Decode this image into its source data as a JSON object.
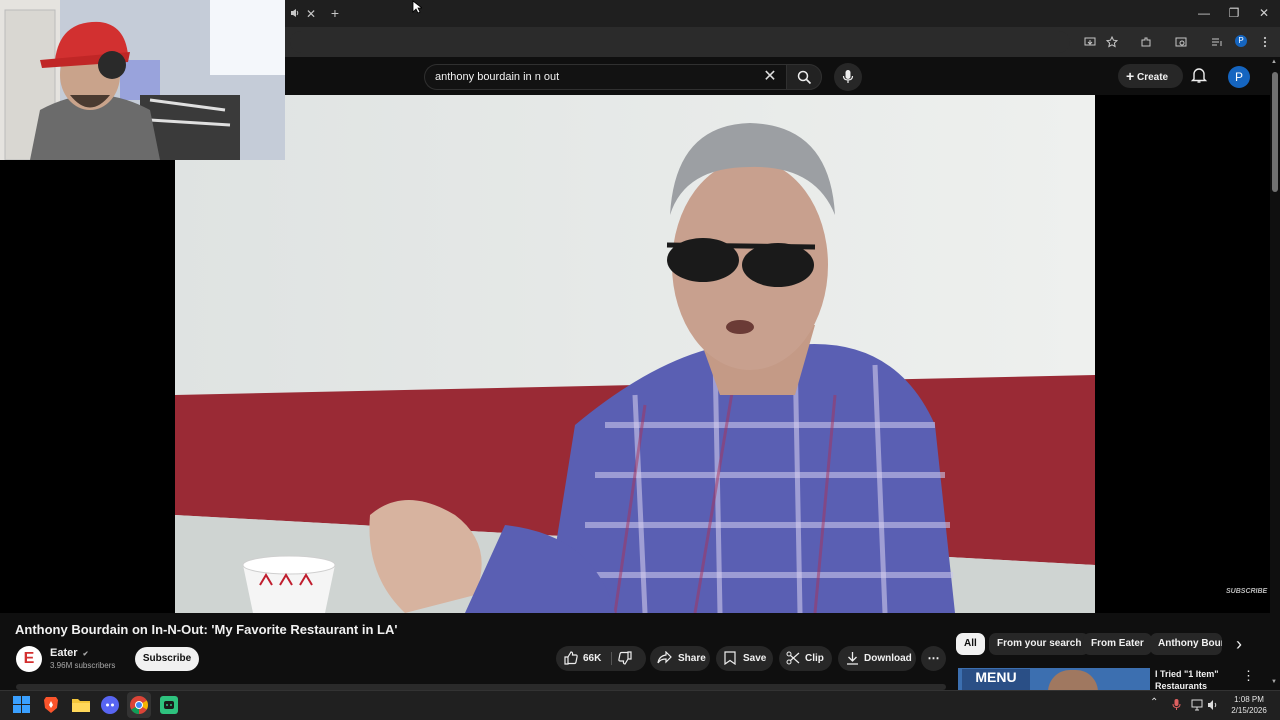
{
  "browser": {
    "new_tab_glyph": "+",
    "tab_close_glyph": "✕",
    "window_controls": {
      "minimize": "—",
      "maximize": "❐",
      "close": "✕"
    }
  },
  "youtube": {
    "search": {
      "value": "anthony bourdain in n out",
      "clear_glyph": "✕"
    },
    "create_label": "Create",
    "avatar_letter": "P"
  },
  "video": {
    "subscribe_watermark": "SUBSCRIBE",
    "title": "Anthony Bourdain on In-N-Out: 'My Favorite Restaurant in LA'",
    "channel": {
      "logo_letter": "E",
      "name": "Eater",
      "verified_glyph": "✔",
      "subscribers": "3.96M subscribers"
    },
    "subscribe_label": "Subscribe",
    "actions": {
      "likes": "66K",
      "share": "Share",
      "save": "Save",
      "clip": "Clip",
      "download": "Download",
      "more": "⋯"
    }
  },
  "sidebar": {
    "chips": [
      "All",
      "From your search",
      "From Eater",
      "Anthony Bourd"
    ],
    "next_glyph": "›",
    "recommendation": {
      "thumb_text": "MENU",
      "title": "I Tried \"1 Item\"",
      "title_line2": "Restaurants",
      "menu_glyph": "⋮"
    }
  },
  "taskbar": {
    "time": "1:08 PM",
    "date": "2/15/2026",
    "tray_chevron": "⌃"
  },
  "colors": {
    "accent": "#1565c0",
    "background": "#0f0f0f",
    "pill": "#272727",
    "brand_red": "#d32f2f"
  }
}
